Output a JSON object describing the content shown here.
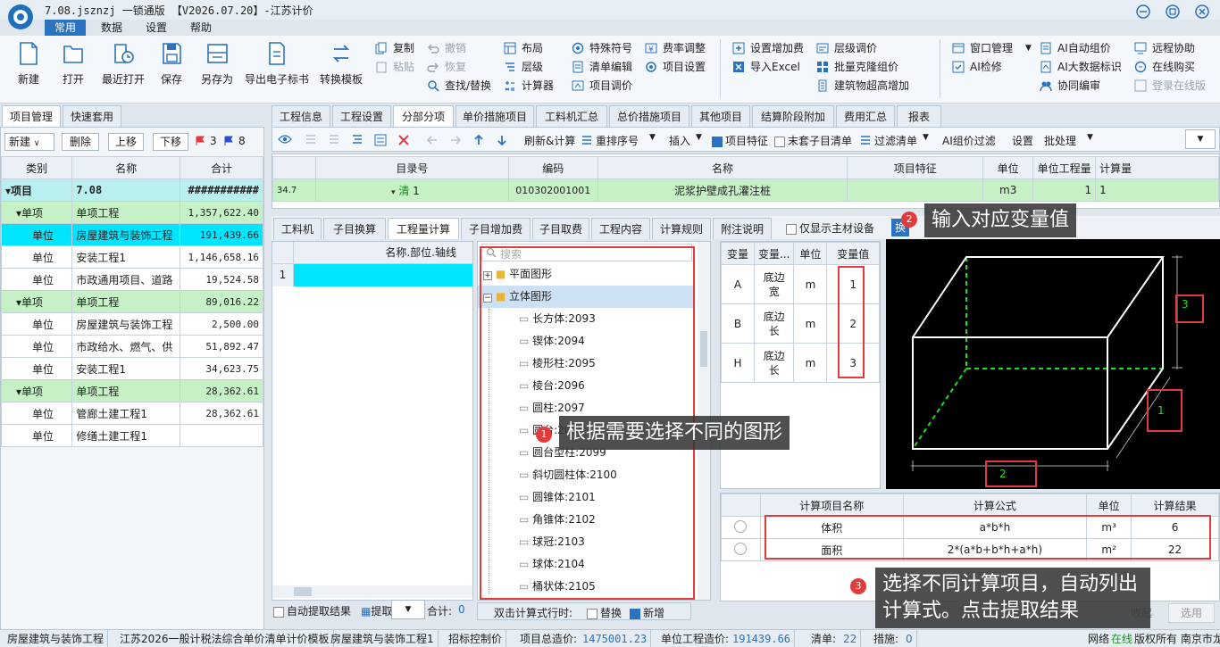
{
  "window": {
    "title": "7.08.jsznzj  一锁通版 【V2026.07.20】-江苏计价"
  },
  "menu": [
    "常用",
    "数据",
    "设置",
    "帮助"
  ],
  "ribbon": {
    "big": [
      "新建",
      "打开",
      "最近打开",
      "保存",
      "另存为",
      "导出电子标书",
      "转换模板"
    ],
    "edit": [
      "复制",
      "粘贴",
      "撤销",
      "恢复",
      "查找/替换"
    ],
    "layout": [
      "布局",
      "层级",
      "计算器"
    ],
    "special": [
      "特殊符号",
      "清单编辑",
      "项目调价"
    ],
    "rate": [
      "费率调整",
      "项目设置"
    ],
    "fees": [
      "设置增加费",
      "导入Excel"
    ],
    "level": [
      "层级调价",
      "批量克隆组价",
      "建筑物超高增加"
    ],
    "window": [
      "窗口管理",
      "AI检修"
    ],
    "ai": [
      "AI自动组价",
      "AI大数据标识",
      "协同编审"
    ],
    "remote": [
      "远程协助",
      "在线购买",
      "登录在线版"
    ]
  },
  "left": {
    "tabs": [
      "项目管理",
      "快速套用"
    ],
    "toolbar": {
      "new": "新建",
      "delete": "删除",
      "up": "上移",
      "down": "下移",
      "red_count": "3",
      "blue_count": "8"
    },
    "headers": [
      "类别",
      "名称",
      "合计"
    ],
    "rows": [
      {
        "cat": "项目",
        "name": "7.08",
        "total": "###########"
      },
      {
        "cat": "单项",
        "name": "单项工程",
        "total": "1,357,622.40"
      },
      {
        "cat": "单位",
        "name": "房屋建筑与装饰工程",
        "total": "191,439.66"
      },
      {
        "cat": "单位",
        "name": "安装工程1",
        "total": "1,146,658.16"
      },
      {
        "cat": "单位",
        "name": "市政通用项目、道路",
        "total": "19,524.58"
      },
      {
        "cat": "单项",
        "name": "单项工程",
        "total": "89,016.22"
      },
      {
        "cat": "单位",
        "name": "房屋建筑与装饰工程",
        "total": "2,500.00"
      },
      {
        "cat": "单位",
        "name": "市政给水、燃气、供",
        "total": "51,892.47"
      },
      {
        "cat": "单位",
        "name": "安装工程1",
        "total": "34,623.75"
      },
      {
        "cat": "单项",
        "name": "单项工程",
        "total": "28,362.61"
      },
      {
        "cat": "单位",
        "name": "管廊土建工程1",
        "total": "28,362.61"
      },
      {
        "cat": "单位",
        "name": "修缮土建工程1",
        "total": ""
      }
    ]
  },
  "main": {
    "tabs": [
      "工程信息",
      "工程设置",
      "分部分项",
      "单价措施项目",
      "工料机汇总",
      "总价措施项目",
      "其他项目",
      "结算阶段附加",
      "费用汇总",
      "报表"
    ],
    "toolbar": [
      "刷新&计算",
      "重排序号",
      "插入",
      "项目特征",
      "末套子目清单",
      "过滤清单",
      "AI组价过滤",
      "设置",
      "批处理"
    ],
    "headers": [
      "目录号",
      "编码",
      "名称",
      "项目特征",
      "单位",
      "单位工程量",
      "计算量"
    ],
    "row": {
      "no": "34.7",
      "mark": "清",
      "idx": "1",
      "code": "010302001001",
      "name": "泥浆护壁成孔灌注桩",
      "unit": "m3",
      "qty": "1",
      "calc": "1"
    }
  },
  "bottom": {
    "tabs": [
      "工料机",
      "子目换算",
      "工程量计算",
      "子目增加费",
      "子目取费",
      "工程内容",
      "计算规则",
      "附注说明"
    ],
    "show_main_label": "仅显示主材设备",
    "swap": "换",
    "left_header": "名称.部位.轴线",
    "left_row": "1",
    "auto_extract": "自动提取结果",
    "extract": "提取",
    "total_label": "合计:",
    "total_value": "0",
    "search_placeholder": "搜索",
    "tree": [
      "平面图形",
      "立体图形",
      "长方体:2093",
      "锲体:2094",
      "棱形柱:2095",
      "棱台:2096",
      "圆柱:2097",
      "圆台:2098",
      "圆台型柱:2099",
      "斜切圆柱体:2100",
      "圆锥体:2101",
      "角锥体:2102",
      "球冠:2103",
      "球体:2104",
      "桶状体:2105"
    ],
    "dbl_label": "双击计算式行时:",
    "replace": "替换",
    "new_line": "新增",
    "var_headers": [
      "变量",
      "变量...",
      "单位",
      "变量值"
    ],
    "vars": [
      {
        "v": "A",
        "name": "底边宽",
        "unit": "m",
        "val": "1"
      },
      {
        "v": "B",
        "name": "底边长",
        "unit": "m",
        "val": "2"
      },
      {
        "v": "H",
        "name": "底边长",
        "unit": "m",
        "val": "3"
      }
    ],
    "dim_labels": [
      "3",
      "1",
      "2"
    ],
    "calc_headers": [
      "计算项目名称",
      "计算公式",
      "单位",
      "计算结果"
    ],
    "calc": [
      {
        "name": "体积",
        "formula": "a*b*h",
        "unit": "m³",
        "result": "6"
      },
      {
        "name": "面积",
        "formula": "2*(a*b+b*h+a*h)",
        "unit": "m²",
        "result": "22"
      }
    ],
    "collapse": "收起",
    "apply": "选用"
  },
  "annotations": {
    "a1": "根据需要选择不同的图形",
    "a2": "输入对应变量值",
    "a3": "选择不同计算项目，自动列出计算式。点击提取结果",
    "n1": "1",
    "n2": "2",
    "n3": "3"
  },
  "status": [
    "房屋建筑与装饰工程",
    "江苏2026一般计税法综合单价清单计价模板",
    "房屋建筑与装饰工程1",
    "招标控制价",
    "项目总造价:",
    "1475001.23",
    "单位工程造价:",
    "191439.66",
    "清单:",
    "22",
    "措施:",
    "0",
    "网络",
    "在线",
    "版权所有  南京市龙"
  ],
  "colors": {
    "accent": "#2b73bf",
    "cyan": "#00e5ff",
    "green_row": "#c6f0c6",
    "red": "#e33b3b"
  }
}
